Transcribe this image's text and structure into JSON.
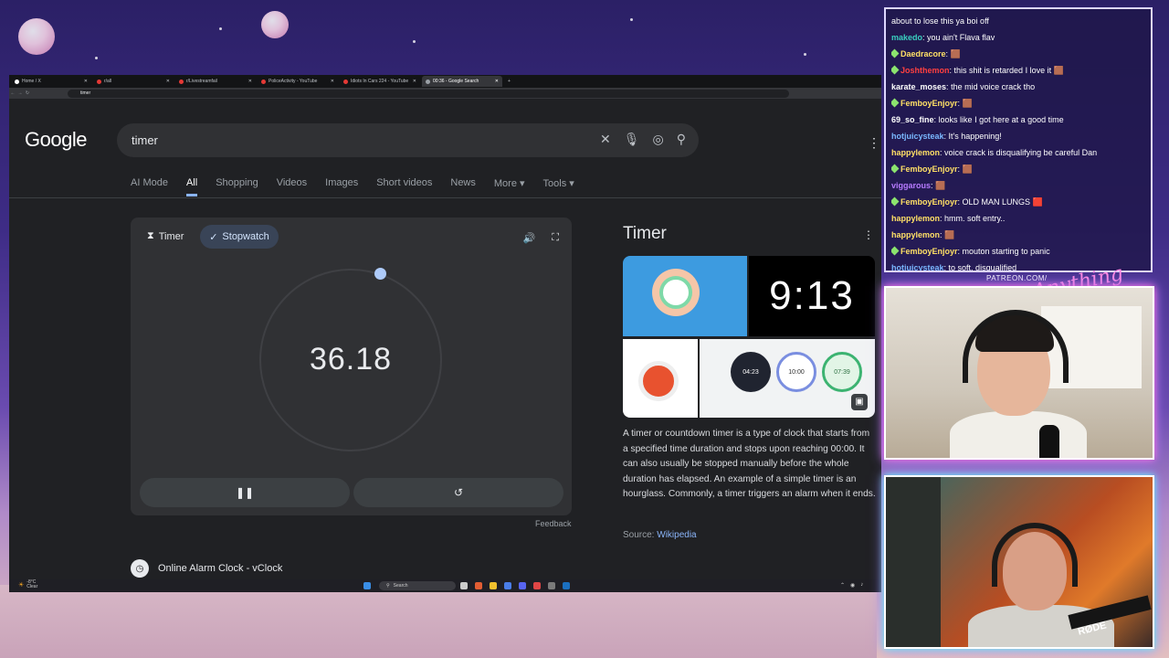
{
  "browser": {
    "tabs": [
      {
        "label": "Home / X",
        "active": false
      },
      {
        "label": "r/all",
        "active": false
      },
      {
        "label": "r/Livestreamfail",
        "active": false
      },
      {
        "label": "PoliceActivity - YouTube",
        "active": false
      },
      {
        "label": "Idiots In Cars 224 - YouTube",
        "active": false
      },
      {
        "label": "00:36 - Google Search",
        "active": true
      }
    ],
    "url": "timer"
  },
  "google": {
    "logo": "Google",
    "query": "timer",
    "nav_tabs": [
      "AI Mode",
      "All",
      "Shopping",
      "Videos",
      "Images",
      "Short videos",
      "News",
      "More",
      "Tools"
    ],
    "active_tab": "All"
  },
  "timer_card": {
    "mode_timer": "Timer",
    "mode_stopwatch": "Stopwatch",
    "active_mode": "Stopwatch",
    "time": "36.18",
    "feedback": "Feedback"
  },
  "result": {
    "title": "Online Alarm Clock - vClock"
  },
  "knowledge_panel": {
    "title": "Timer",
    "image_clock_text": "9:13",
    "mini_clocks": [
      "04:23",
      "10:00",
      "07:39"
    ],
    "description": "A timer or countdown timer is a type of clock that starts from a specified time duration and stops upon reaching 00:00. It can also usually be stopped manually before the whole duration has elapsed. An example of a simple timer is an hourglass. Commonly, a timer triggers an alarm when it ends.",
    "source_label": "Source:",
    "source_link": "Wikipedia"
  },
  "taskbar": {
    "weather_temp": "-8°C",
    "weather_desc": "Clear",
    "search": "Search"
  },
  "chat": {
    "messages": [
      {
        "user": "",
        "text": "about to lose this ya boi off",
        "color": "#ffffff",
        "badge": false
      },
      {
        "user": "makedo",
        "text": "you ain't Flava flav",
        "color": "#3ad0c0",
        "badge": false
      },
      {
        "user": "Daedracore",
        "text": "🟫",
        "color": "#ffe066",
        "badge": true
      },
      {
        "user": "Joshthemon",
        "text": "this shit is retarded I love it 🟫",
        "color": "#ff4040",
        "badge": true
      },
      {
        "user": "karate_moses",
        "text": "the mid voice crack tho",
        "color": "#ffffff",
        "badge": false
      },
      {
        "user": "FemboyEnjoyr",
        "text": "🟫",
        "color": "#ffe066",
        "badge": true
      },
      {
        "user": "69_so_fine",
        "text": "looks like I got here at a good time",
        "color": "#ffffff",
        "badge": false
      },
      {
        "user": "hotjuicysteak",
        "text": "It's happening!",
        "color": "#7ab8ff",
        "badge": false
      },
      {
        "user": "happylemon",
        "text": "voice crack is disqualifying be careful Dan",
        "color": "#ffe066",
        "badge": false
      },
      {
        "user": "FemboyEnjoyr",
        "text": "🟫",
        "color": "#ffe066",
        "badge": true
      },
      {
        "user": "viggarous",
        "text": "🟫",
        "color": "#b77bff",
        "badge": false
      },
      {
        "user": "FemboyEnjoyr",
        "text": "OLD MAN LUNGS 🟥",
        "color": "#ffe066",
        "badge": true
      },
      {
        "user": "happylemon",
        "text": "hmm. soft entry..",
        "color": "#ffe066",
        "badge": false
      },
      {
        "user": "happylemon",
        "text": "🟫",
        "color": "#ffe066",
        "badge": false
      },
      {
        "user": "FemboyEnjoyr",
        "text": "mouton starting to panic",
        "color": "#ffe066",
        "badge": true
      },
      {
        "user": "hotjuicysteak",
        "text": "to soft, disqualified",
        "color": "#7ab8ff",
        "badge": false
      }
    ]
  },
  "overlay": {
    "patreon": "PATREON.COM/",
    "signature": "Anything Else?",
    "mic_brand": "RØDE"
  }
}
